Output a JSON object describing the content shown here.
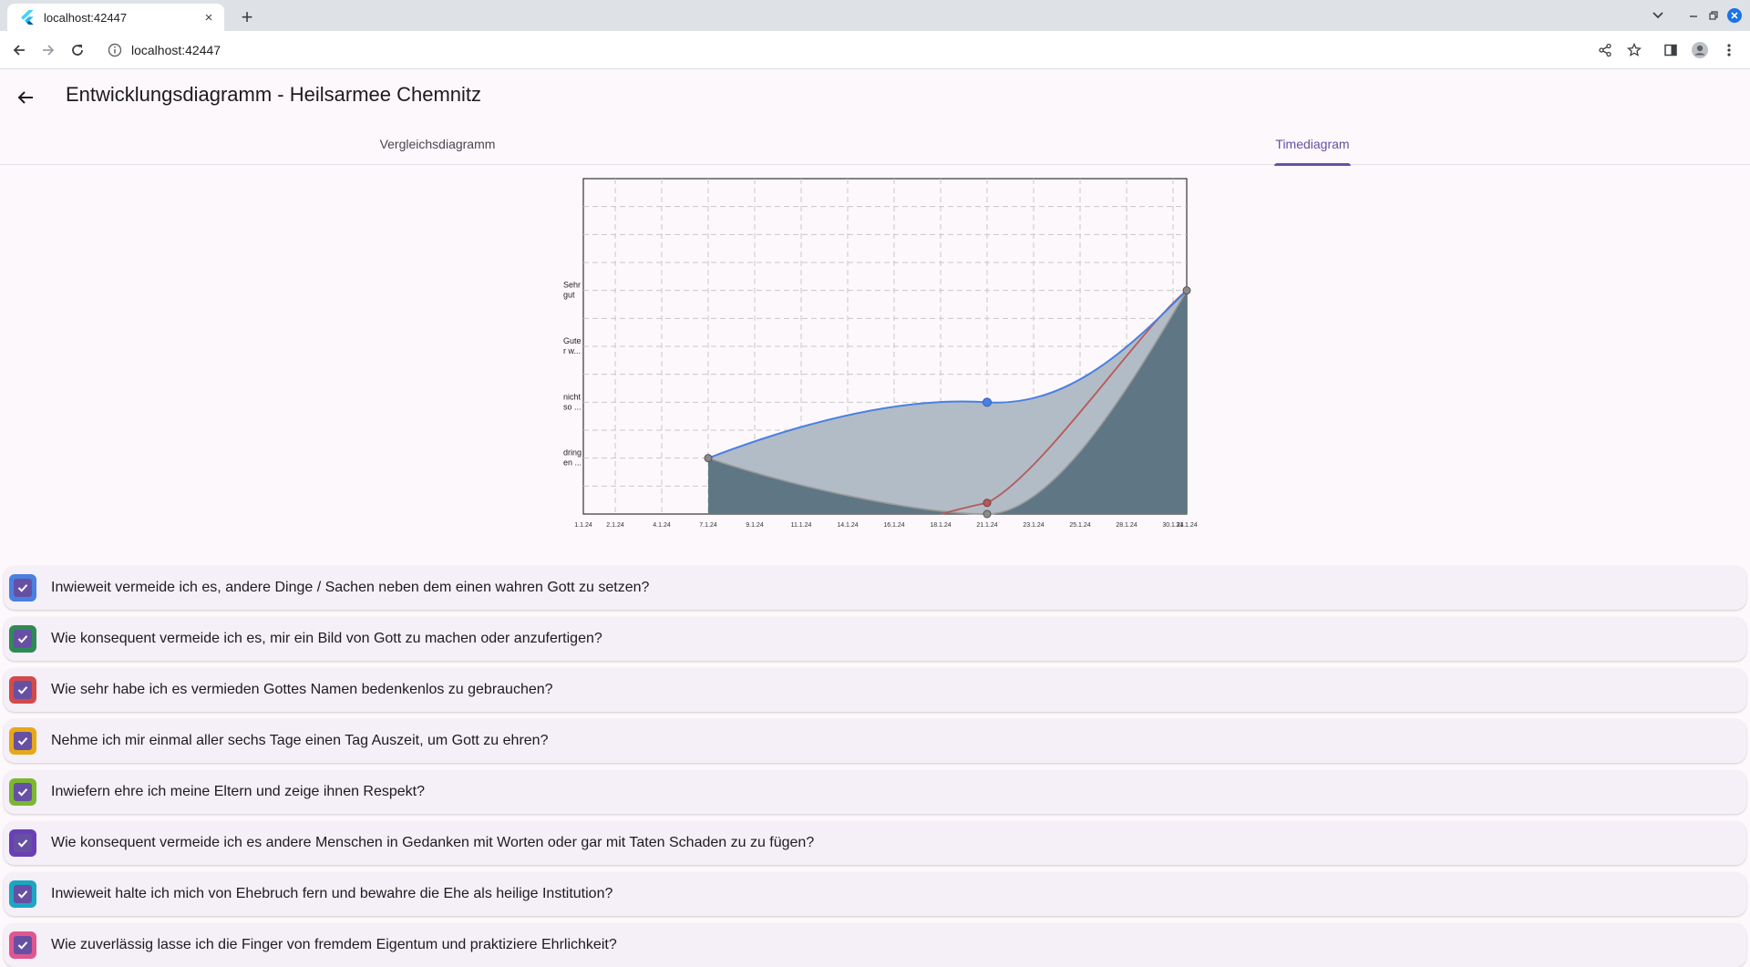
{
  "browser": {
    "tab_title": "localhost:42447",
    "tab_close": "×",
    "new_tab": "+",
    "url": "localhost:42447",
    "window_controls": [
      "⌄",
      "–",
      "❐",
      "✕"
    ]
  },
  "app": {
    "title": "Entwicklungsdiagramm - Heilsarmee Chemnitz",
    "tabs": [
      {
        "label": "Vergleichsdiagramm",
        "active": false
      },
      {
        "label": "Timediagram",
        "active": true
      }
    ]
  },
  "chart_data": {
    "type": "area",
    "y_labels": [
      {
        "level": 1,
        "text": [
          "dring",
          "en ..."
        ]
      },
      {
        "level": 2,
        "text": [
          "nicht",
          "so ..."
        ]
      },
      {
        "level": 3,
        "text": [
          "Gute",
          "r w..."
        ]
      },
      {
        "level": 4,
        "text": [
          "Sehr",
          "gut"
        ]
      }
    ],
    "x_ticks": [
      "1.1.24",
      "2.1.24",
      "4.1.24",
      "7.1.24",
      "9.1.24",
      "11.1.24",
      "14.1.24",
      "16.1.24",
      "18.1.24",
      "21.1.24",
      "23.1.24",
      "25.1.24",
      "28.1.24",
      "30.1.24",
      "31.1.24"
    ],
    "ylim": [
      0,
      6
    ],
    "grid": true,
    "series": [
      {
        "color": "#4a80e0",
        "points": [
          {
            "x": "7.1.24",
            "y": 1
          },
          {
            "x": "21.1.24",
            "y": 2
          },
          {
            "x": "31.1.24",
            "y": 4
          }
        ]
      },
      {
        "color": "#b65a5a",
        "points": [
          {
            "x": "21.1.24",
            "y": 0.2
          },
          {
            "x": "31.1.24",
            "y": 4
          }
        ]
      },
      {
        "color": "#8a8a8a",
        "points": [
          {
            "x": "7.1.24",
            "y": 1
          },
          {
            "x": "21.1.24",
            "y": 0
          },
          {
            "x": "31.1.24",
            "y": 4
          }
        ]
      }
    ]
  },
  "questions": [
    {
      "text": "Inwieweit vermeide ich es, andere Dinge / Sachen neben dem einen wahren Gott zu setzen?",
      "color": "#4a80e0"
    },
    {
      "text": "Wie konsequent vermeide ich es, mir ein Bild von Gott zu machen oder anzufertigen?",
      "color": "#2e8b57"
    },
    {
      "text": "Wie sehr habe ich es vermieden Gottes Namen bedenkenlos zu gebrauchen?",
      "color": "#d24b4b"
    },
    {
      "text": "Nehme ich mir einmal aller sechs Tage einen Tag Auszeit, um Gott zu ehren?",
      "color": "#e6a819"
    },
    {
      "text": "Inwiefern ehre ich meine Eltern und zeige ihnen Respekt?",
      "color": "#7cb82f"
    },
    {
      "text": "Wie konsequent vermeide ich es andere Menschen in Gedanken mit Worten oder gar mit Taten Schaden zu zu fügen?",
      "color": "#6a3fb5"
    },
    {
      "text": "Inwieweit halte ich mich von Ehebruch fern und bewahre die Ehe als heilige Institution?",
      "color": "#1ba7c4"
    },
    {
      "text": "Wie zuverlässig lasse ich die Finger von fremdem Eigentum und praktiziere Ehrlichkeit?",
      "color": "#e0578f"
    }
  ]
}
